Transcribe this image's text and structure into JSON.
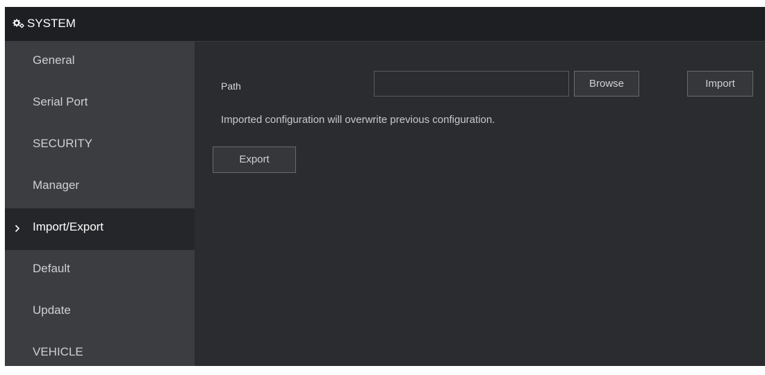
{
  "header": {
    "title": "SYSTEM",
    "icon": "gears-icon"
  },
  "sidebar": {
    "items": [
      {
        "label": "General"
      },
      {
        "label": "Serial Port"
      },
      {
        "label": "SECURITY"
      },
      {
        "label": "Manager"
      },
      {
        "label": "Import/Export",
        "active": true
      },
      {
        "label": "Default"
      },
      {
        "label": "Update"
      },
      {
        "label": "VEHICLE"
      }
    ]
  },
  "main": {
    "path_label": "Path",
    "path_value": "",
    "browse_label": "Browse",
    "import_label": "Import",
    "notice": "Imported configuration will overwrite previous configuration.",
    "export_label": "Export"
  },
  "colors": {
    "header_bg": "#1e1f22",
    "sidebar_bg": "#3c3d41",
    "sidebar_active_bg": "#25262a",
    "content_bg": "#2b2c30"
  }
}
